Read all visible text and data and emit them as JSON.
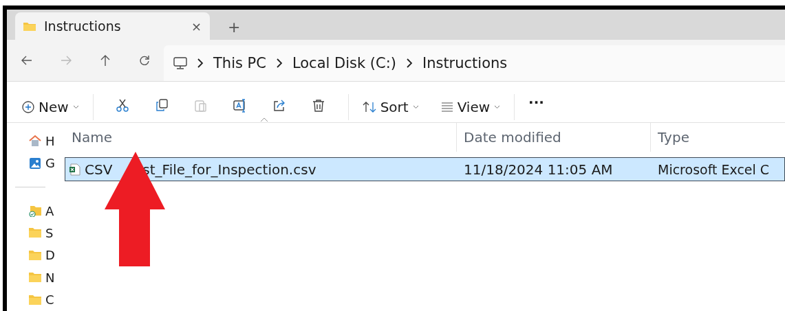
{
  "tabs": [
    {
      "title": "Instructions",
      "close": "×",
      "selected": true
    }
  ],
  "new_tab": "+",
  "nav": [
    {
      "kind": "back",
      "disabled": false
    },
    {
      "kind": "forward",
      "disabled": true
    },
    {
      "kind": "up",
      "disabled": false
    },
    {
      "kind": "refresh",
      "disabled": false
    }
  ],
  "breadcrumb": [
    "This PC",
    "Local Disk (C:)",
    "Instructions"
  ],
  "toolbar": {
    "new": "New",
    "sort": "Sort",
    "view": "View",
    "more": "···",
    "icons": [
      {
        "kind": "cut",
        "disabled": false
      },
      {
        "kind": "copy",
        "disabled": false
      },
      {
        "kind": "paste",
        "disabled": true
      },
      {
        "kind": "rename",
        "disabled": false
      },
      {
        "kind": "share",
        "disabled": false
      },
      {
        "kind": "delete",
        "disabled": false
      }
    ]
  },
  "sidebar": {
    "items": [
      {
        "kind": "home",
        "label": "H"
      },
      {
        "kind": "gallery",
        "label": "G"
      },
      {
        "kind": "divider"
      },
      {
        "kind": "synced",
        "label": "A"
      },
      {
        "kind": "folder",
        "label": "S"
      },
      {
        "kind": "folder",
        "label": "D"
      },
      {
        "kind": "folder",
        "label": "N"
      },
      {
        "kind": "folder",
        "label": "C"
      }
    ]
  },
  "table": {
    "columns": [
      "Name",
      "Date modified",
      "Type"
    ],
    "rows": [
      {
        "name_start": "CSV",
        "name_end": "st_File_for_Inspection.csv",
        "date": "11/18/2024 11:05 AM",
        "type": "Microsoft Excel C",
        "selected": true
      }
    ]
  }
}
